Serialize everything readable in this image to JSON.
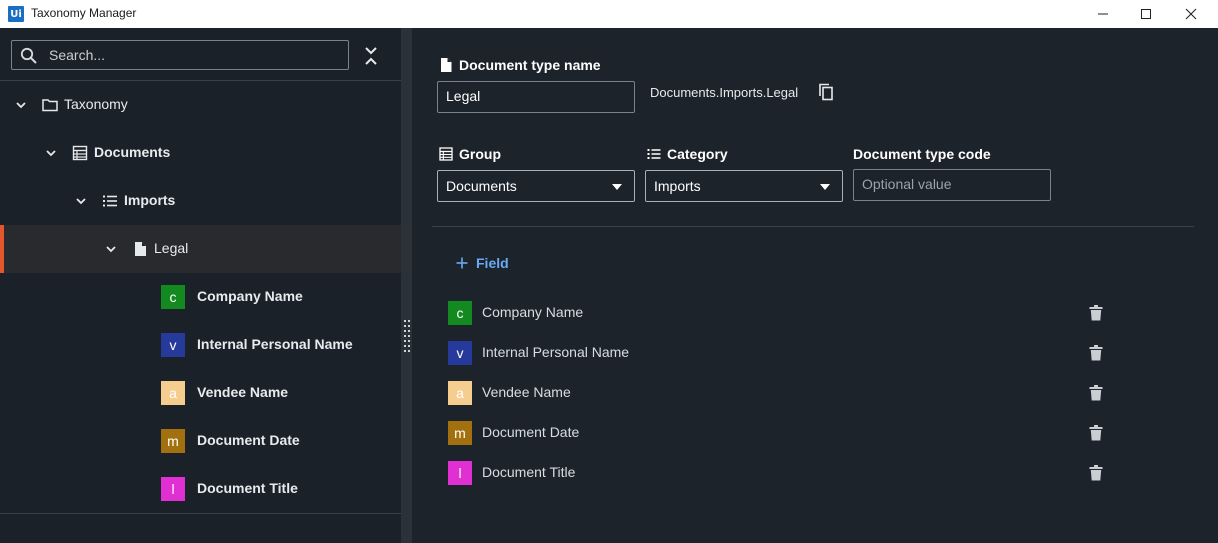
{
  "window": {
    "app_icon_text": "Ui",
    "title": "Taxonomy Manager"
  },
  "sidebar": {
    "search_placeholder": "Search...",
    "tree": [
      {
        "label": "Taxonomy",
        "level": 0,
        "icon": "folder-icon"
      },
      {
        "label": "Documents",
        "level": 1,
        "icon": "group-table-icon"
      },
      {
        "label": "Imports",
        "level": 2,
        "icon": "list-icon"
      },
      {
        "label": "Legal",
        "level": 3,
        "icon": "document-icon",
        "selected": true
      }
    ],
    "fields": [
      {
        "letter": "c",
        "label": "Company Name",
        "color": "#138a1f"
      },
      {
        "letter": "v",
        "label": "Internal Personal Name",
        "color": "#253a9a"
      },
      {
        "letter": "a",
        "label": "Vendee Name",
        "color": "#f5cd8f"
      },
      {
        "letter": "m",
        "label": "Document Date",
        "color": "#a3700f"
      },
      {
        "letter": "l",
        "label": "Document Title",
        "color": "#e02fd2"
      }
    ]
  },
  "main": {
    "doc_type_name_label": "Document type name",
    "doc_type_name_value": "Legal",
    "full_path": "Documents.Imports.Legal",
    "group_label": "Group",
    "group_value": "Documents",
    "category_label": "Category",
    "category_value": "Imports",
    "doc_type_code_label": "Document type code",
    "doc_type_code_placeholder": "Optional value",
    "add_field_label": "Field",
    "fields": [
      {
        "letter": "c",
        "label": "Company Name",
        "color": "#138a1f"
      },
      {
        "letter": "v",
        "label": "Internal Personal Name",
        "color": "#253a9a"
      },
      {
        "letter": "a",
        "label": "Vendee Name",
        "color": "#f5cd8f"
      },
      {
        "letter": "m",
        "label": "Document Date",
        "color": "#a3700f"
      },
      {
        "letter": "l",
        "label": "Document Title",
        "color": "#e02fd2"
      }
    ]
  },
  "colors": {
    "accent": "#e4572e",
    "link": "#6aa9f5",
    "background": "#1c232b"
  }
}
